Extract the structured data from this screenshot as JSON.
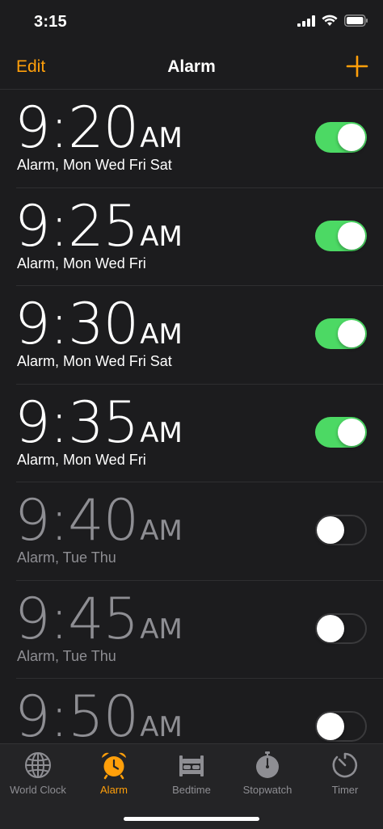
{
  "status_bar": {
    "time": "3:15"
  },
  "nav": {
    "edit_label": "Edit",
    "title": "Alarm",
    "add_icon": "plus-icon"
  },
  "alarms": [
    {
      "time": "9:20",
      "ampm": "AM",
      "label": "Alarm, Mon Wed Fri Sat",
      "enabled": true
    },
    {
      "time": "9:25",
      "ampm": "AM",
      "label": "Alarm, Mon Wed Fri",
      "enabled": true
    },
    {
      "time": "9:30",
      "ampm": "AM",
      "label": "Alarm, Mon Wed Fri Sat",
      "enabled": true
    },
    {
      "time": "9:35",
      "ampm": "AM",
      "label": "Alarm, Mon Wed Fri",
      "enabled": true
    },
    {
      "time": "9:40",
      "ampm": "AM",
      "label": "Alarm, Tue Thu",
      "enabled": false
    },
    {
      "time": "9:45",
      "ampm": "AM",
      "label": "Alarm, Tue Thu",
      "enabled": false
    },
    {
      "time": "9:50",
      "ampm": "AM",
      "label": "",
      "enabled": false
    }
  ],
  "tabs": [
    {
      "label": "World Clock",
      "icon": "globe-icon",
      "active": false
    },
    {
      "label": "Alarm",
      "icon": "alarm-clock-icon",
      "active": true
    },
    {
      "label": "Bedtime",
      "icon": "bed-icon",
      "active": false
    },
    {
      "label": "Stopwatch",
      "icon": "stopwatch-icon",
      "active": false
    },
    {
      "label": "Timer",
      "icon": "timer-icon",
      "active": false
    }
  ],
  "colors": {
    "accent": "#ff9f0a",
    "toggle_on": "#4cd964",
    "background": "#1c1c1e",
    "inactive_text": "#8e8e93"
  }
}
